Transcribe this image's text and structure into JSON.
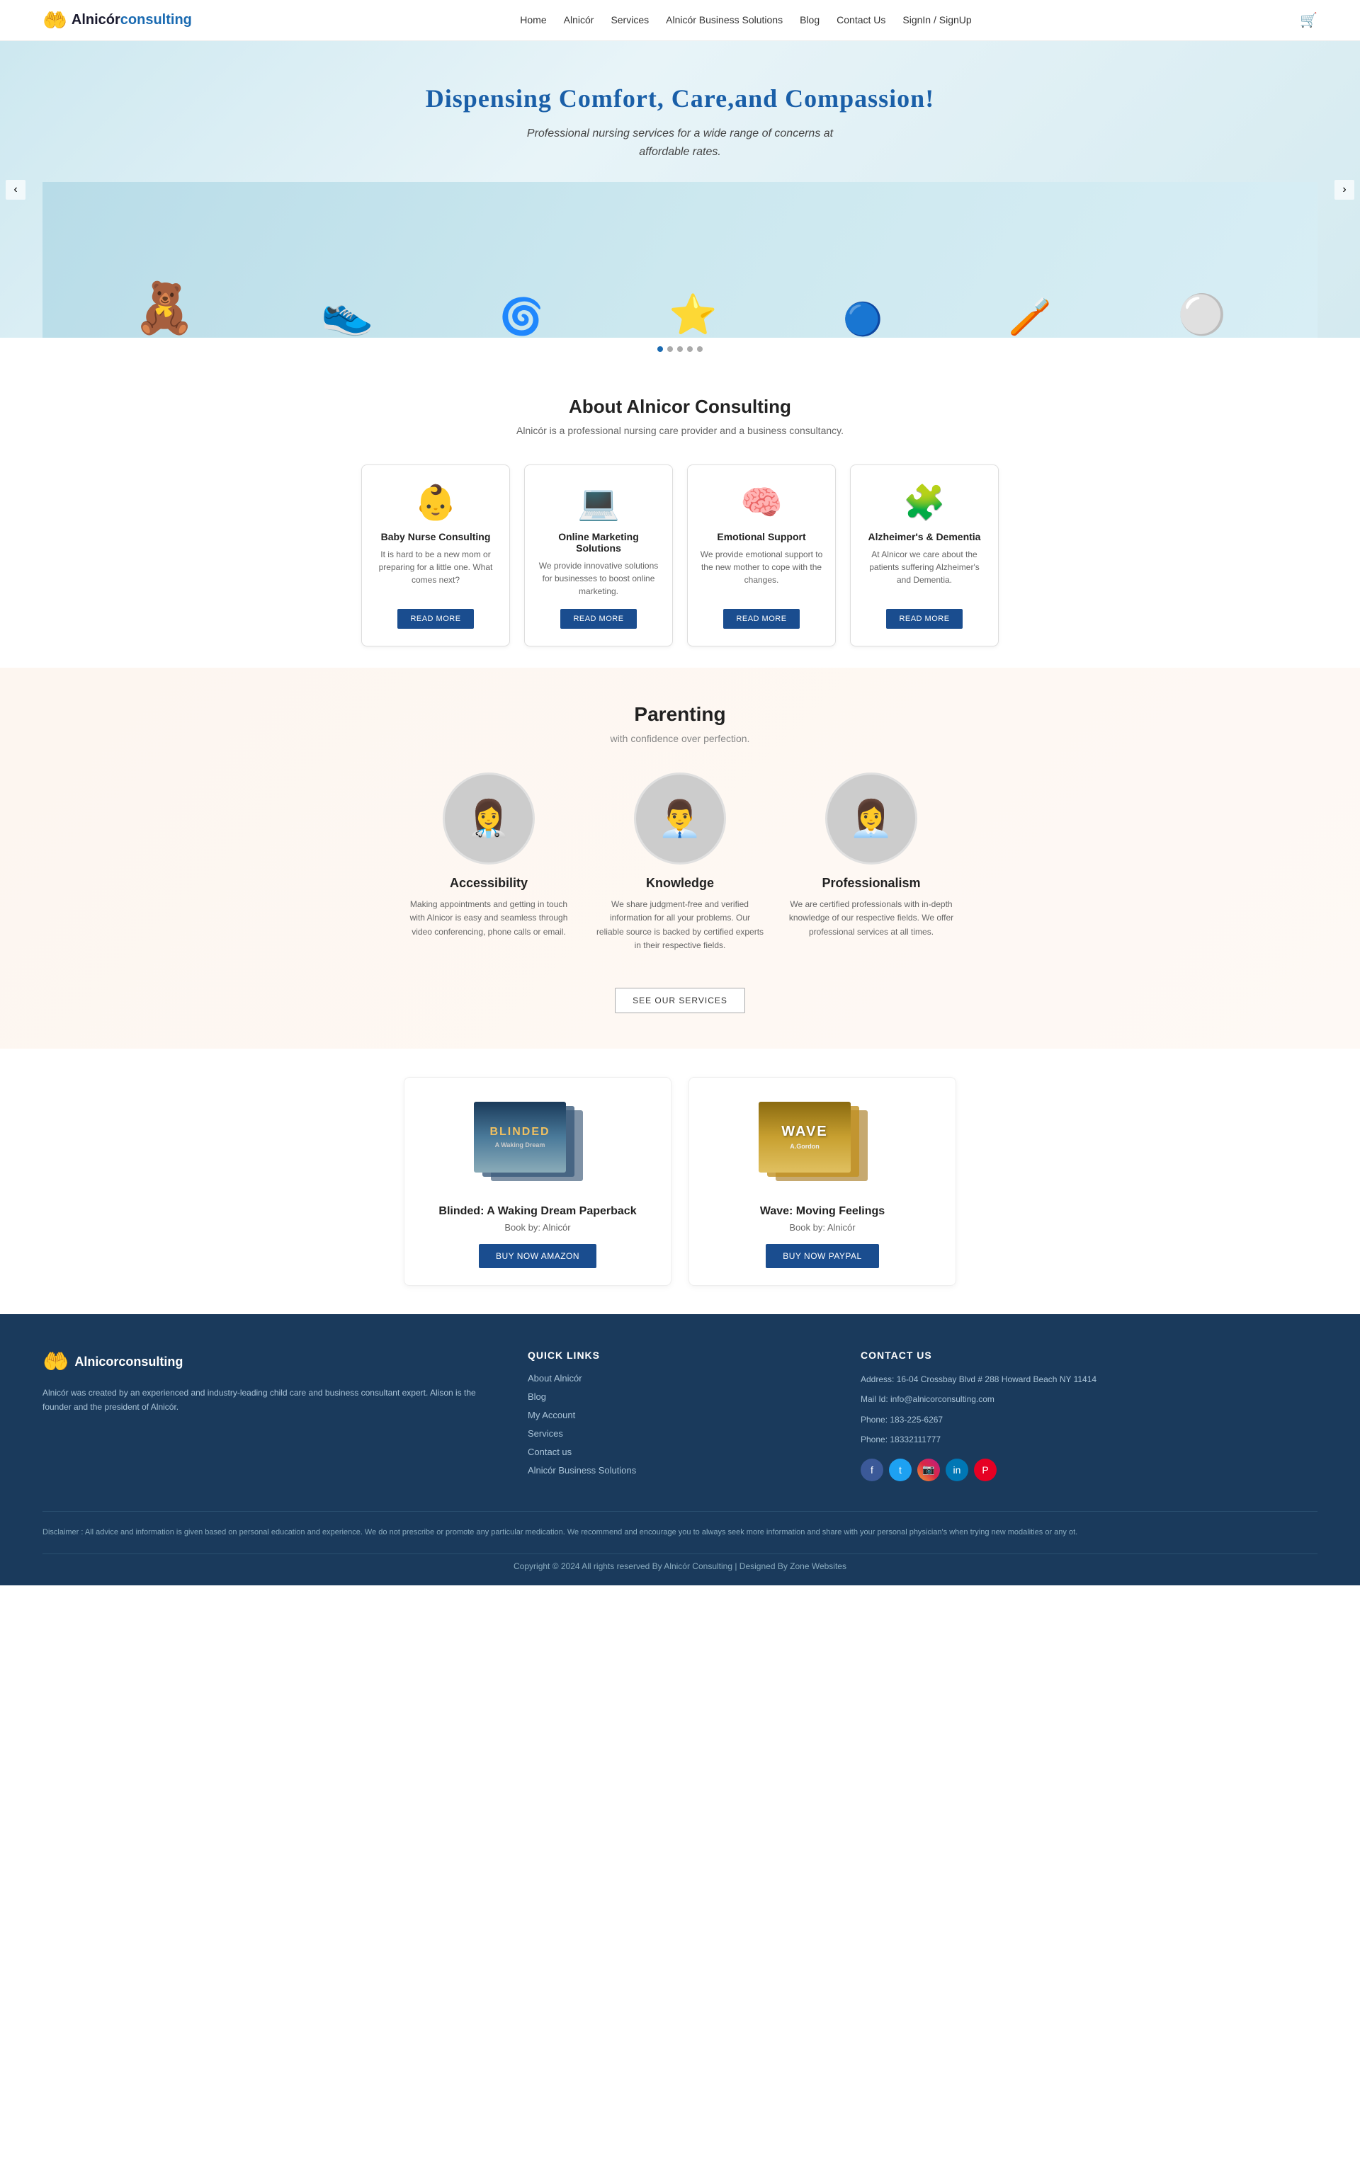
{
  "brand": {
    "name_part1": "Alnicór",
    "name_part2": "consulting",
    "logo_icon": "🤲"
  },
  "nav": {
    "links": [
      {
        "label": "Home",
        "href": "#"
      },
      {
        "label": "Alnicór",
        "href": "#"
      },
      {
        "label": "Services",
        "href": "#"
      },
      {
        "label": "Alnicór Business Solutions",
        "href": "#"
      },
      {
        "label": "Blog",
        "href": "#"
      },
      {
        "label": "Contact Us",
        "href": "#"
      },
      {
        "label": "SignIn / SignUp",
        "href": "#"
      }
    ]
  },
  "hero": {
    "title": "Dispensing Comfort, Care,and Compassion!",
    "subtitle": "Professional nursing services for a wide range of concerns at affordable rates."
  },
  "about": {
    "title": "About Alnicor Consulting",
    "subtitle": "Alnicór is a professional nursing care provider and a business consultancy.",
    "cards": [
      {
        "icon": "👶",
        "title": "Baby Nurse Consulting",
        "desc": "It is hard to be a new mom or preparing for a little one. What comes next?",
        "btn": "READ MORE"
      },
      {
        "icon": "💻",
        "title": "Online Marketing Solutions",
        "desc": "We provide innovative solutions for businesses to boost online marketing.",
        "btn": "READ MORE"
      },
      {
        "icon": "🧠",
        "title": "Emotional Support",
        "desc": "We provide emotional support to the new mother to cope with the changes.",
        "btn": "READ MORE"
      },
      {
        "icon": "🧩",
        "title": "Alzheimer's & Dementia",
        "desc": "At Alnicor we care about the patients suffering Alzheimer's and Dementia.",
        "btn": "READ MORE"
      }
    ]
  },
  "parenting": {
    "title": "Parenting",
    "subtitle": "with confidence over perfection.",
    "cards": [
      {
        "avatar": "👩‍⚕️",
        "title": "Accessibility",
        "desc": "Making appointments and getting in touch with Alnicor is easy and seamless through video conferencing, phone calls or email."
      },
      {
        "avatar": "👨‍💼",
        "title": "Knowledge",
        "desc": "We share judgment-free and verified information for all your problems. Our reliable source is backed by certified experts in their respective fields."
      },
      {
        "avatar": "👩‍💼",
        "title": "Professionalism",
        "desc": "We are certified professionals with in-depth knowledge of our respective fields. We offer professional services at all times."
      }
    ],
    "btn_services": "SEE OUR SERVICES"
  },
  "books": [
    {
      "title": "Blinded: A Waking Dream Paperback",
      "author": "Book by:  Alnicór",
      "btn": "BUY NOW AMAZON",
      "cover_text": "BLINDED",
      "cover_color": "#3a5a7a"
    },
    {
      "title": "Wave: Moving Feelings",
      "author": "Book by:  Alnicór",
      "btn": "BUY NOW PAYPAL",
      "cover_text": "WAVE",
      "cover_color": "#c8a020"
    }
  ],
  "footer": {
    "logo_icon": "🤲",
    "logo_text": "Alnicorconsulting",
    "desc": "Alnicór was created by an experienced and industry-leading child care and business consultant expert. Alison is the founder and the president of Alnicór.",
    "quick_links_title": "QUICK LINKS",
    "quick_links": [
      {
        "label": "About Alnicór",
        "href": "#"
      },
      {
        "label": "Blog",
        "href": "#"
      },
      {
        "label": "My Account",
        "href": "#"
      },
      {
        "label": "Services",
        "href": "#"
      },
      {
        "label": "Contact us",
        "href": "#"
      },
      {
        "label": "Alnicór Business Solutions",
        "href": "#"
      }
    ],
    "contact_title": "CONTACT US",
    "address": "Address: 16-04 Crossbay Blvd # 288 Howard Beach NY 11414",
    "phone1": "Phone: 183-225-6267",
    "mail": "Mail Id: info@alnicorconsulting.com",
    "phone2": "Phone: 18332111777",
    "social": [
      {
        "name": "facebook",
        "icon": "f",
        "class": "social-fb"
      },
      {
        "name": "twitter",
        "icon": "t",
        "class": "social-tw"
      },
      {
        "name": "instagram",
        "icon": "📷",
        "class": "social-ig"
      },
      {
        "name": "linkedin",
        "icon": "in",
        "class": "social-li"
      },
      {
        "name": "pinterest",
        "icon": "P",
        "class": "social-pi"
      }
    ],
    "disclaimer": "Disclaimer : All advice and information is given based on personal education and experience. We do not prescribe or promote any particular medication. We recommend and encourage you to always seek more information and share with your personal physician's when trying new modalities or any ot.",
    "copyright": "Copyright © 2024 All rights reserved By Alnicór Consulting | Designed By Zone Websites"
  }
}
